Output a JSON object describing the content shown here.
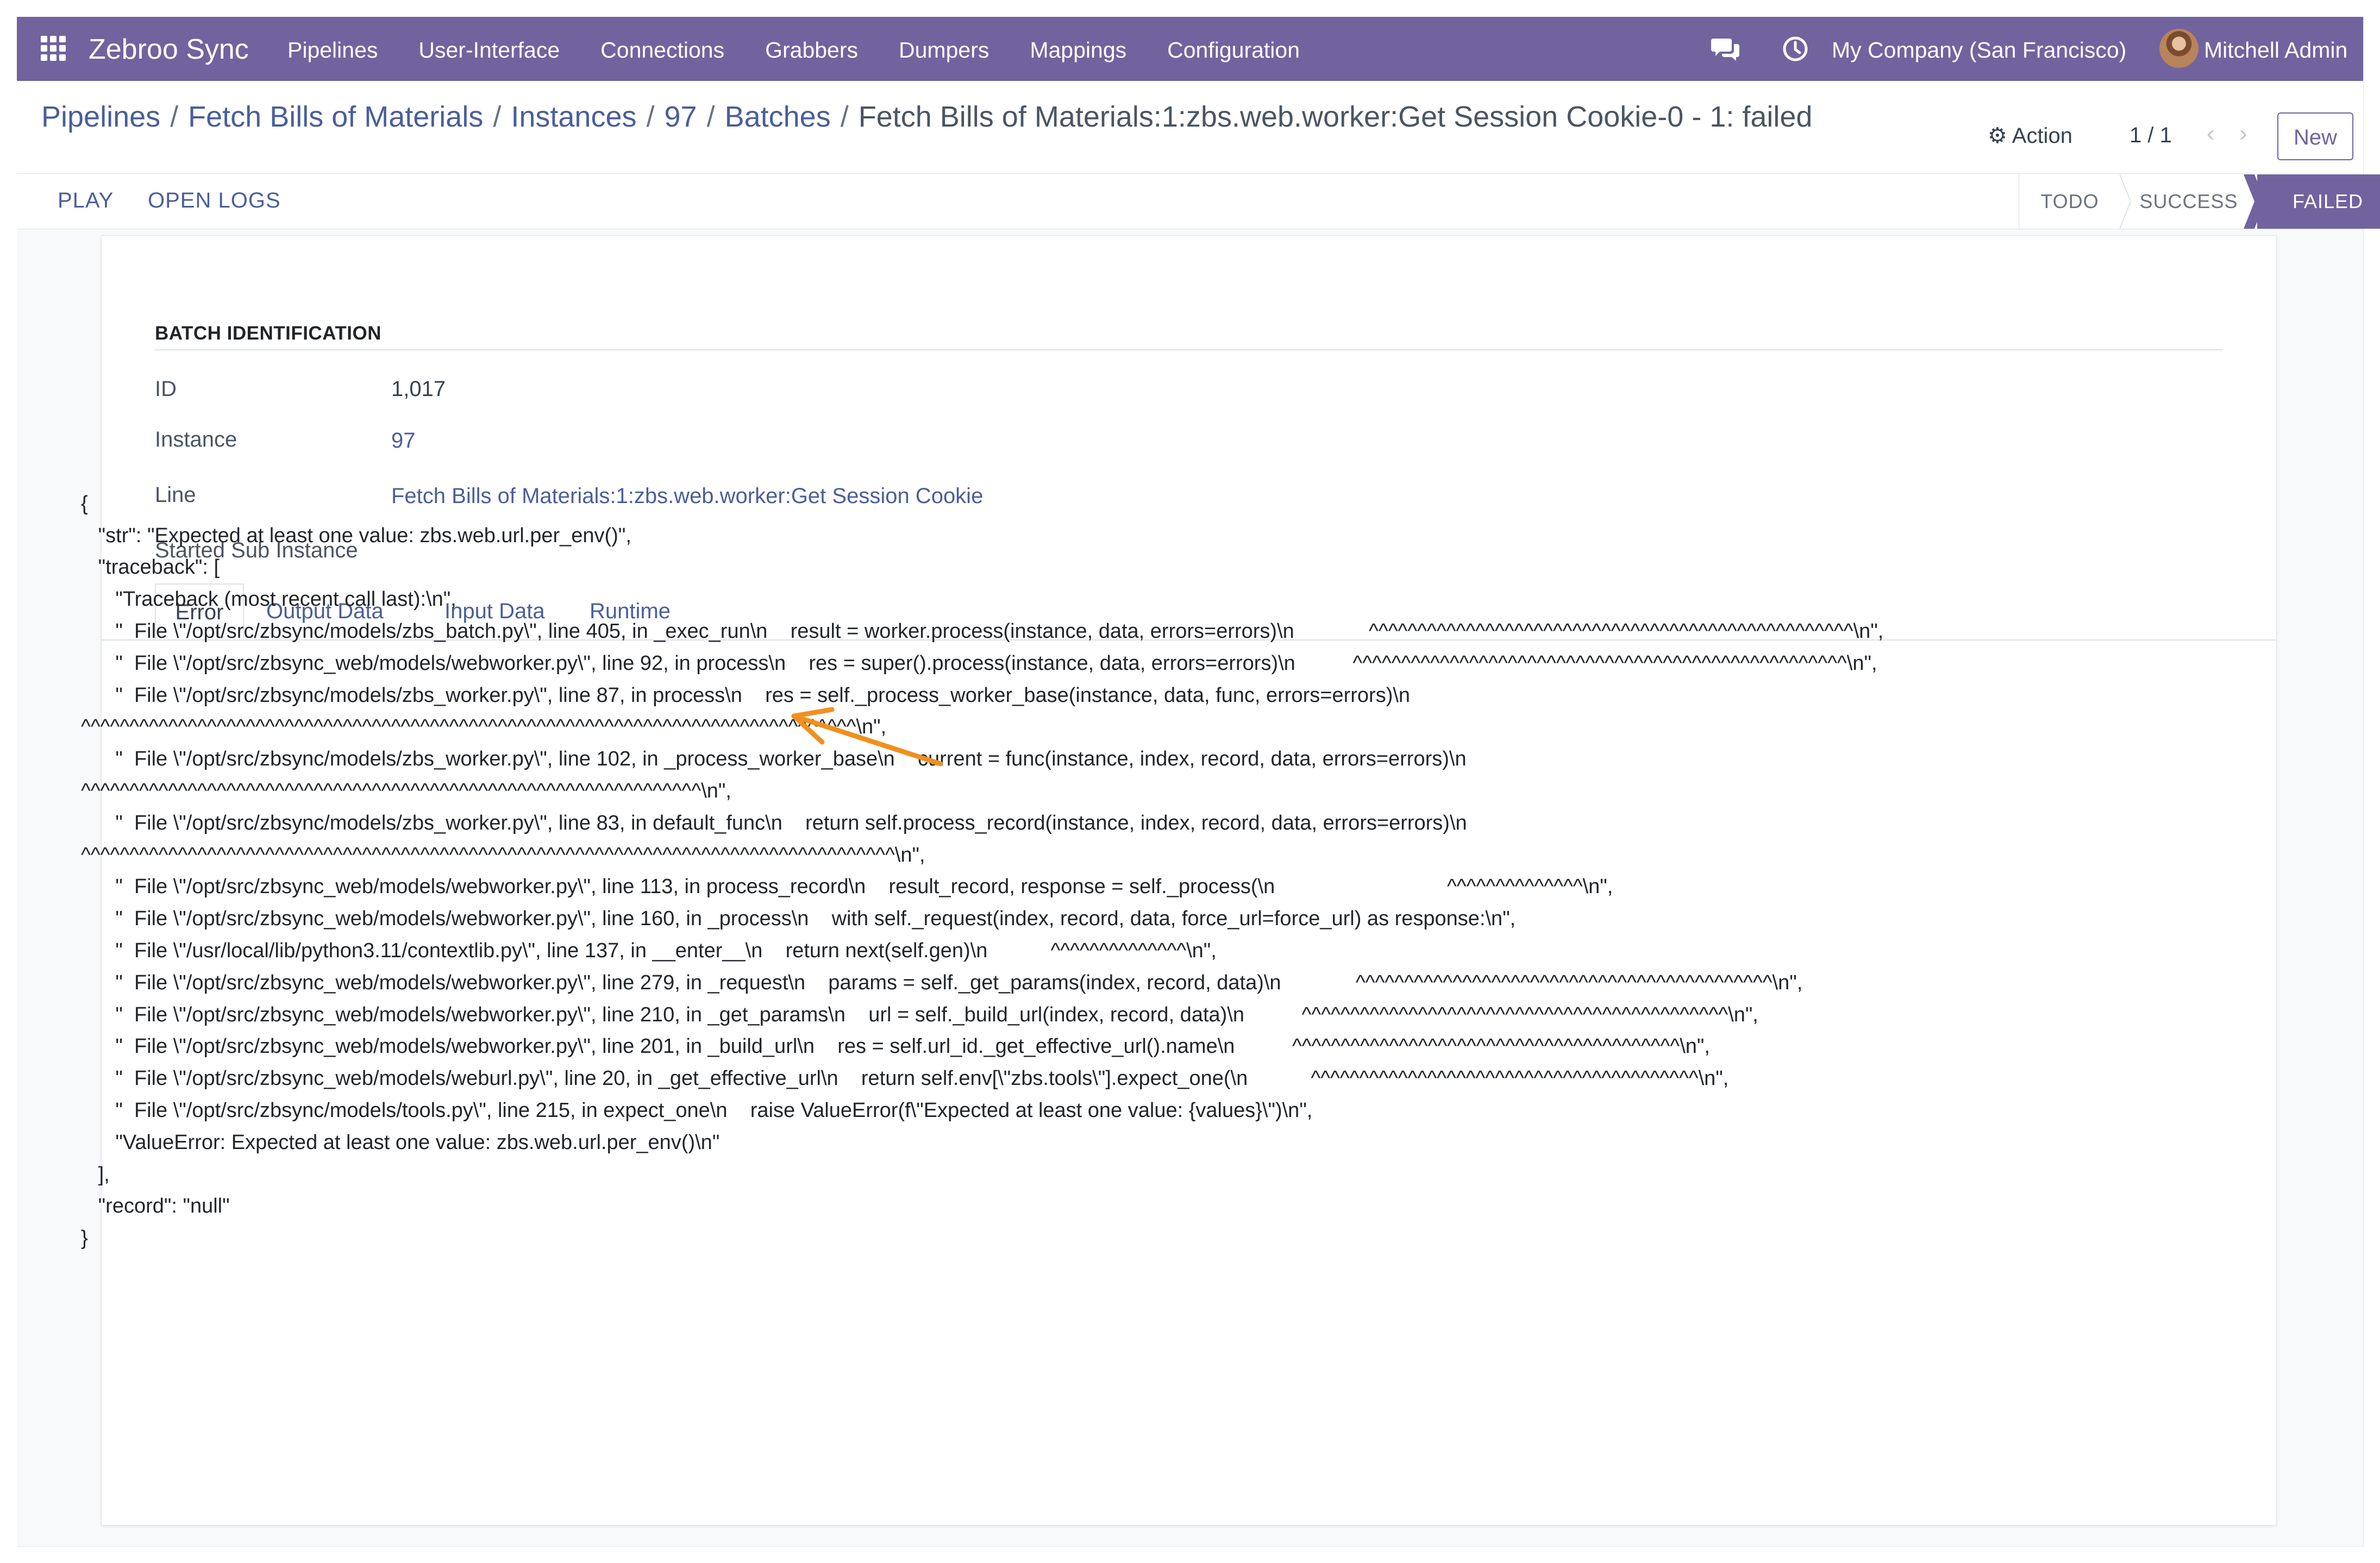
{
  "navbar": {
    "brand": "Zebroo Sync",
    "menu": [
      "Pipelines",
      "User-Interface",
      "Connections",
      "Grabbers",
      "Dumpers",
      "Mappings",
      "Configuration"
    ],
    "company": "My Company (San Francisco)",
    "user": "Mitchell Admin",
    "brand_color": "#71639e"
  },
  "breadcrumb": {
    "items": [
      "Pipelines",
      "Fetch Bills of Materials",
      "Instances",
      "97",
      "Batches"
    ],
    "current": "Fetch Bills of Materials:1:zbs.web.worker:Get Session Cookie-0 - 1: failed",
    "separator": "/"
  },
  "toolbar": {
    "action_label": "Action",
    "pager": "1 / 1",
    "new_label": "New",
    "play_label": "PLAY",
    "open_logs_label": "OPEN LOGS"
  },
  "statusbar": {
    "stages": [
      "TODO",
      "SUCCESS",
      "FAILED"
    ],
    "active": "FAILED"
  },
  "form": {
    "group_title": "BATCH IDENTIFICATION",
    "fields": [
      {
        "label": "ID",
        "value": "1,017"
      },
      {
        "label": "Instance",
        "value": "97"
      },
      {
        "label": "Line",
        "value": "Fetch Bills of Materials:1:zbs.web.worker:Get Session Cookie"
      },
      {
        "label": "Started Sub Instance",
        "value": ""
      }
    ],
    "tabs": [
      "Error",
      "Output Data",
      "Input Data",
      "Runtime"
    ],
    "active_tab": "Error"
  },
  "error_json": [
    "{",
    "   \"str\": \"Expected at least one value: zbs.web.url.per_env()\",",
    "   \"traceback\": [",
    "      \"Traceback (most recent call last):\\n\",",
    "      \"  File \\\"/opt/src/zbsync/models/zbs_batch.py\\\", line 405, in _exec_run\\n    result = worker.process(instance, data, errors=errors)\\n             ^^^^^^^^^^^^^^^^^^^^^^^^^^^^^^^^^^^^^^^^^^^^^^^^^^\\n\",",
    "      \"  File \\\"/opt/src/zbsync_web/models/webworker.py\\\", line 92, in process\\n    res = super().process(instance, data, errors=errors)\\n          ^^^^^^^^^^^^^^^^^^^^^^^^^^^^^^^^^^^^^^^^^^^^^^^^^^^\\n\",",
    "      \"  File \\\"/opt/src/zbsync/models/zbs_worker.py\\\", line 87, in process\\n    res = self._process_worker_base(instance, data, func, errors=errors)\\n",
    "^^^^^^^^^^^^^^^^^^^^^^^^^^^^^^^^^^^^^^^^^^^^^^^^^^^^^^^^^^^^^^^^^^^^^^^^^^^^^^^^\\n\",",
    "      \"  File \\\"/opt/src/zbsync/models/zbs_worker.py\\\", line 102, in _process_worker_base\\n    current = func(instance, index, record, data, errors=errors)\\n",
    "^^^^^^^^^^^^^^^^^^^^^^^^^^^^^^^^^^^^^^^^^^^^^^^^^^^^^^^^^^^^^^^^\\n\",",
    "      \"  File \\\"/opt/src/zbsync/models/zbs_worker.py\\\", line 83, in default_func\\n    return self.process_record(instance, index, record, data, errors=errors)\\n",
    "^^^^^^^^^^^^^^^^^^^^^^^^^^^^^^^^^^^^^^^^^^^^^^^^^^^^^^^^^^^^^^^^^^^^^^^^^^^^^^^^^^^^\\n\",",
    "      \"  File \\\"/opt/src/zbsync_web/models/webworker.py\\\", line 113, in process_record\\n    result_record, response = self._process(\\n                              ^^^^^^^^^^^^^^\\n\",",
    "      \"  File \\\"/opt/src/zbsync_web/models/webworker.py\\\", line 160, in _process\\n    with self._request(index, record, data, force_url=force_url) as response:\\n\",",
    "      \"  File \\\"/usr/local/lib/python3.11/contextlib.py\\\", line 137, in __enter__\\n    return next(self.gen)\\n           ^^^^^^^^^^^^^^\\n\",",
    "      \"  File \\\"/opt/src/zbsync_web/models/webworker.py\\\", line 279, in _request\\n    params = self._get_params(index, record, data)\\n             ^^^^^^^^^^^^^^^^^^^^^^^^^^^^^^^^^^^^^^^^^^^\\n\",",
    "      \"  File \\\"/opt/src/zbsync_web/models/webworker.py\\\", line 210, in _get_params\\n    url = self._build_url(index, record, data)\\n          ^^^^^^^^^^^^^^^^^^^^^^^^^^^^^^^^^^^^^^^^^^^^\\n\",",
    "      \"  File \\\"/opt/src/zbsync_web/models/webworker.py\\\", line 201, in _build_url\\n    res = self.url_id._get_effective_url().name\\n          ^^^^^^^^^^^^^^^^^^^^^^^^^^^^^^^^^^^^^^^^\\n\",",
    "      \"  File \\\"/opt/src/zbsync_web/models/weburl.py\\\", line 20, in _get_effective_url\\n    return self.env[\\\"zbs.tools\\\"].expect_one(\\n           ^^^^^^^^^^^^^^^^^^^^^^^^^^^^^^^^^^^^^^^^\\n\",",
    "      \"  File \\\"/opt/src/zbsync/models/tools.py\\\", line 215, in expect_one\\n    raise ValueError(f\\\"Expected at least one value: {values}\\\")\\n\",",
    "      \"ValueError: Expected at least one value: zbs.web.url.per_env()\\n\"",
    "   ],",
    "   \"record\": \"null\"",
    "}"
  ],
  "annotation": {
    "arrow_color": "#f0901e"
  }
}
